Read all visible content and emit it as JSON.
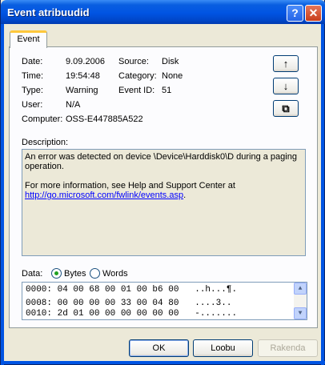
{
  "window": {
    "title": "Event atribuudid"
  },
  "tab": {
    "label": "Event"
  },
  "fields": {
    "date_label": "Date:",
    "date_value": "9.09.2006",
    "source_label": "Source:",
    "source_value": "Disk",
    "time_label": "Time:",
    "time_value": "19:54:48",
    "category_label": "Category:",
    "category_value": "None",
    "type_label": "Type:",
    "type_value": "Warning",
    "eventid_label": "Event ID:",
    "eventid_value": "51",
    "user_label": "User:",
    "user_value": "N/A",
    "computer_label": "Computer:",
    "computer_value": "OSS-E447885A522"
  },
  "description": {
    "label": "Description:",
    "line1": "An error was detected on device \\Device\\Harddisk0\\D during a paging",
    "line2": "operation.",
    "line3": "For more information, see Help and Support Center at",
    "link": "http://go.microsoft.com/fwlink/events.asp",
    "link_suffix": "."
  },
  "data": {
    "label": "Data:",
    "bytes_label": "Bytes",
    "words_label": "Words",
    "selected": "Bytes",
    "rows": [
      "0000: 04 00 68 00 01 00 b6 00   ..h...¶.",
      "0008: 00 00 00 00 33 00 04 80   ....3..",
      "0010: 2d 01 00 00 00 00 00 00   -......."
    ]
  },
  "buttons": {
    "ok": "OK",
    "cancel": "Loobu",
    "apply": "Rakenda"
  },
  "nav": {
    "up": "↑",
    "down": "↓",
    "copy": "⧉"
  }
}
